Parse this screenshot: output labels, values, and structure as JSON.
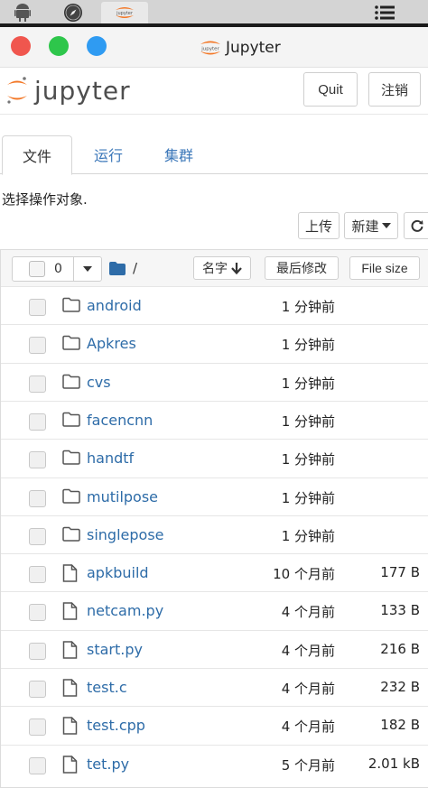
{
  "window": {
    "title": "Jupyter"
  },
  "header": {
    "logo_text": "jupyter",
    "quit_label": "Quit",
    "logout_label": "注销"
  },
  "tabs": [
    {
      "label": "文件",
      "active": true
    },
    {
      "label": "运行",
      "active": false
    },
    {
      "label": "集群",
      "active": false
    }
  ],
  "hint": "选择操作对象.",
  "toolbar": {
    "upload_label": "上传",
    "new_label": "新建"
  },
  "list_header": {
    "selected_count": "0",
    "path": "/",
    "name_label": "名字",
    "modified_label": "最后修改",
    "size_label": "File size"
  },
  "files": [
    {
      "name": "android",
      "type": "folder",
      "modified": "1 分钟前",
      "size": ""
    },
    {
      "name": "Apkres",
      "type": "folder",
      "modified": "1 分钟前",
      "size": ""
    },
    {
      "name": "cvs",
      "type": "folder",
      "modified": "1 分钟前",
      "size": ""
    },
    {
      "name": "facencnn",
      "type": "folder",
      "modified": "1 分钟前",
      "size": ""
    },
    {
      "name": "handtf",
      "type": "folder",
      "modified": "1 分钟前",
      "size": ""
    },
    {
      "name": "mutilpose",
      "type": "folder",
      "modified": "1 分钟前",
      "size": ""
    },
    {
      "name": "singlepose",
      "type": "folder",
      "modified": "1 分钟前",
      "size": ""
    },
    {
      "name": "apkbuild",
      "type": "file",
      "modified": "10 个月前",
      "size": "177 B"
    },
    {
      "name": "netcam.py",
      "type": "file",
      "modified": "4 个月前",
      "size": "133 B"
    },
    {
      "name": "start.py",
      "type": "file",
      "modified": "4 个月前",
      "size": "216 B"
    },
    {
      "name": "test.c",
      "type": "file",
      "modified": "4 个月前",
      "size": "232 B"
    },
    {
      "name": "test.cpp",
      "type": "file",
      "modified": "4 个月前",
      "size": "182 B"
    },
    {
      "name": "tet.py",
      "type": "file",
      "modified": "5 个月前",
      "size": "2.01 kB"
    }
  ],
  "colors": {
    "link": "#2e6ca8",
    "folder_icon": "#2e6ca8",
    "tab_link": "#3b77b9",
    "logo_orange": "#f37726"
  }
}
